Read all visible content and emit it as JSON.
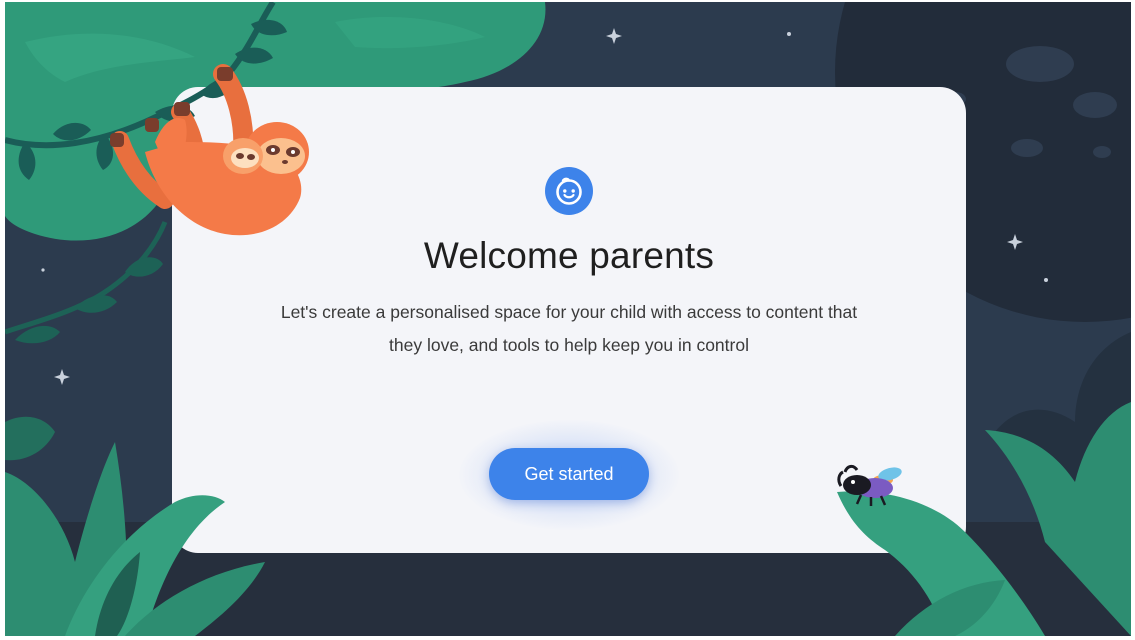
{
  "welcome": {
    "title": "Welcome parents",
    "description": "Let's create a personalised space for your child with access to content that they love, and tools to help keep you in control",
    "get_started_label": "Get started"
  },
  "icons": {
    "badge": "smiley-face-icon"
  },
  "colors": {
    "accent": "#3d83ea",
    "card": "#f4f5f9",
    "background": "#2b3a4d",
    "foliage": "#2f9a79",
    "sloth": "#f47a48"
  }
}
